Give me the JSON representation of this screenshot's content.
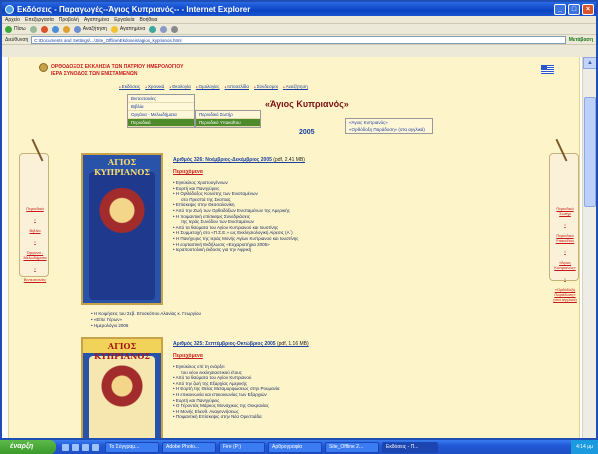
{
  "window": {
    "title": "Εκδόσεις - Παραγωγές--Άγιος Κυπριανός-- - Internet Explorer",
    "minimize_icon": "minimize-icon",
    "maximize_icon": "maximize-icon",
    "close_icon": "close-icon"
  },
  "menubar": [
    "Αρχείο",
    "Επεξεργασία",
    "Προβολή",
    "Αγαπημένα",
    "Εργαλεία",
    "Βοήθεια"
  ],
  "toolbar": {
    "back": "Πίσω",
    "search": "Αναζήτηση",
    "favorites": "Αγαπημένα"
  },
  "address": {
    "label": "Διεύθυνση",
    "value": "C:\\Documents and Settings\\...\\Site_Offline\\Ekdoseis\\agios_kyprianos.html",
    "go": "Μετάβαση"
  },
  "site": {
    "church_name_line1": "ΟΡΘΟΔΟΞΟΣ ΕΚΚΛΗΣΙΑ ΤΩΝ ΠΑΤΡΙΟΥ ΗΜΕΡΟΛΟΓΙΟΥ",
    "church_name_line2": "ΙΕΡΑ ΣΥΝΟΔΟΣ ΤΩΝ ΕΝΙΣΤΑΜΕΝΩΝ"
  },
  "topnav": [
    "Εκδόσεις",
    "Χρονικά",
    "Θεολογία",
    "Ομολογίες",
    "Ιστοσελίδα",
    "Σύνδεσμοι",
    "Αναζήτηση"
  ],
  "dropdown1": [
    "Βιντεοταινίες",
    "Βιβλία",
    "Οργάνα - Μελωδήματα",
    "Περιοδικά"
  ],
  "dropdown2": [
    "Περιοδικό Σωτήρ",
    "Περιοδικό Υπακοΐτου"
  ],
  "dropdown3": [
    "«Άγιος Κυπριανός»",
    "«Ορθόδοξη Παράδοση» (στα αγγλικά)"
  ],
  "main_title": "«Άγιος Κυπριανός»",
  "year": "2005",
  "left_sidebar": [
    "Περιοδικά",
    "Βιβλία",
    "Όργανα - Μελωδήματα",
    "Βιντεοταινίες"
  ],
  "right_sidebar": [
    "Περιοδικό Σωτήρ",
    "Περιοδικό Υπακοΐτου",
    "«Άγιος Κυπριανός»",
    "«Ορθόδοξη Παράδοση» (στα αγγλικά)"
  ],
  "issue1": {
    "cover_title": "ΑΓΙΟΣ ΚΥΠΡΙΑΝΟΣ",
    "heading": "Αριθμός 326: Νοέμβριος-Δεκέμβριος 2005",
    "size": "(pdf, 2.41 MB)",
    "subheading": "Περιεχόμενα",
    "toc": [
      "Εγκύκλιος Χριστουγέννων",
      "Εορτή και Πανηγύρεις",
      "Η Ορθόδοξος Κοινότης των Ενισταμένων",
      "στο Πρεσπά της Σκοπιας",
      "Επίσκεψις στην Θεσσαλονίκη",
      "Από την Ζωή των Ορθοδόξων Ενισταμένων της Αμερικής",
      "Η ποιμαντική επίσκεψις Συνεδριάσεις",
      "της Ιεράς Συνόδου των Ενισταμένων",
      "Από τα θαύματα του Αγίου Κυπριανού και Ιουστίνης",
      "Η Συμμετοχή στο «Π.Σ.Ε.» ως Εκκλησιολογική Αίρεσις (Α΄)",
      "Η Πανήγυρις της Ιεράς Μονής Αγίων Κυπριανού και Ιουστίνης",
      "Η εορταστική Εκδήλωσις «Ευχαριστήρια 2005»",
      "Ιεραποστολική έκδοσις για την Αφρική"
    ],
    "extras": [
      "Η Κοιμήσεις του Σεβ. Επισκόπου Αλανίας κ. Γεωργίου",
      "«Είπε Γέρων»",
      "Ημερολόγιο 2006"
    ]
  },
  "issue2": {
    "cover_title": "ΑΓΙΟΣ ΚΥΠΡΙΑΝΟΣ",
    "heading": "Αριθμός 325: Σεπτέμβριος-Οκτώβριος 2005",
    "size": "(pdf, 1.16 MB)",
    "subheading": "Περιεχόμενα",
    "toc": [
      "Εγκύκλιος επί τη ενάρξει",
      "του νέου εκκλησιαστικού έτους",
      "Από τα θαύματα του Αγίου Κυπριανού",
      "Από την ζωή της Εξαρχίας Αμερικής",
      "Η Εορτή της Θείας Μεταμορφώσεως στην Ρουμανία",
      "Η επικοινωνία και επικοινωνίας των Εξαρχιών",
      "Εορτή και Πανηγύρεις",
      "Ο Γέροντάς Μάρκος Μοναχικος της Ουκρανίας",
      "Η Μονής Ελευθ. Αναγεννήσεως",
      "Ποιμαντική Επίσκεψις στην Νέα Ορεστιάδα"
    ]
  },
  "taskbar": {
    "start": "έναρξη",
    "tasks": [
      "Το Σύγγραμ...",
      "Adobe Photo...",
      "Fire (P:)",
      "Αρθρογραφία",
      "Site_Offline 2...",
      "Εκδόσεις - Π..."
    ],
    "clock": "4:14 μμ"
  },
  "colors": {
    "page_bg": "#fdf5c9",
    "link": "#1a3fa0",
    "accent_red": "#c81a1a",
    "menu_active": "#4c8a2a",
    "titlebar": "#0a43c2"
  }
}
